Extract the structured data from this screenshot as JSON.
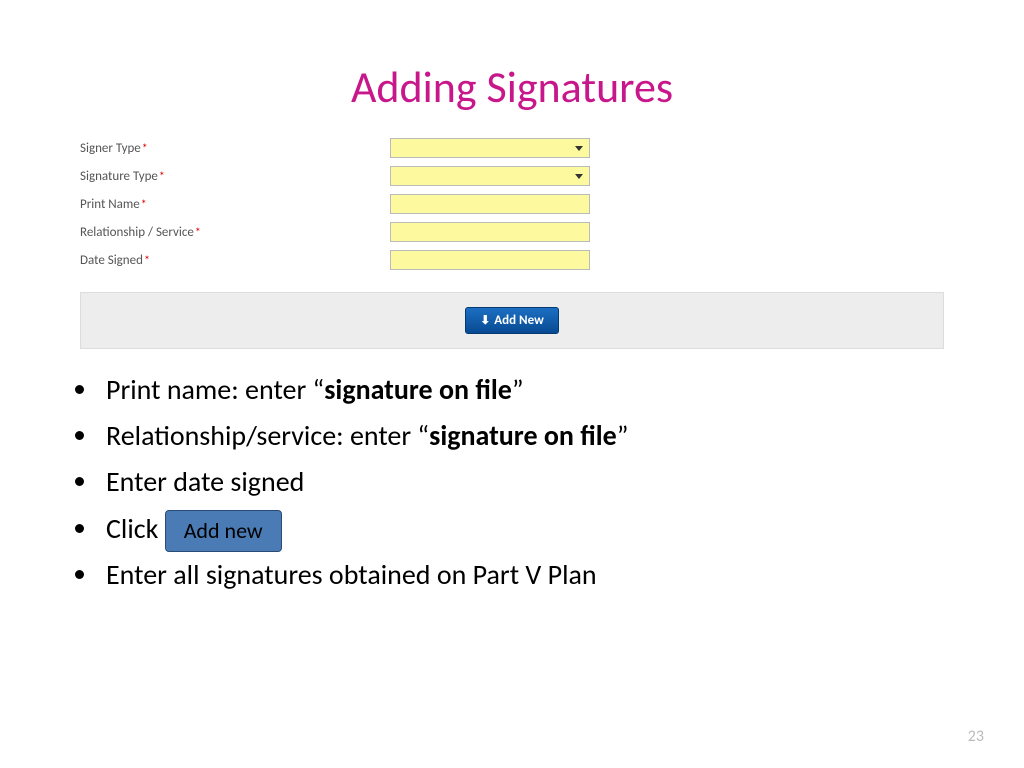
{
  "title": "Adding Signatures",
  "form": {
    "rows": [
      {
        "label": "Signer Type",
        "type": "select"
      },
      {
        "label": "Signature Type",
        "type": "select"
      },
      {
        "label": "Print Name",
        "type": "text"
      },
      {
        "label": "Relationship / Service",
        "type": "text"
      },
      {
        "label": "Date Signed",
        "type": "text"
      }
    ],
    "required_mark": "*",
    "add_button": "Add New"
  },
  "bullets": {
    "b1_pre": "Print name: enter “",
    "b1_bold": "signature on file",
    "b1_post": "”",
    "b2_pre": "Relationship/service: enter “",
    "b2_bold": "signature on file",
    "b2_post": "”",
    "b3": "Enter date signed",
    "b4_pre": "Click ",
    "b4_btn": "Add new",
    "b5": "Enter all signatures obtained on Part V Plan"
  },
  "page_number": "23"
}
